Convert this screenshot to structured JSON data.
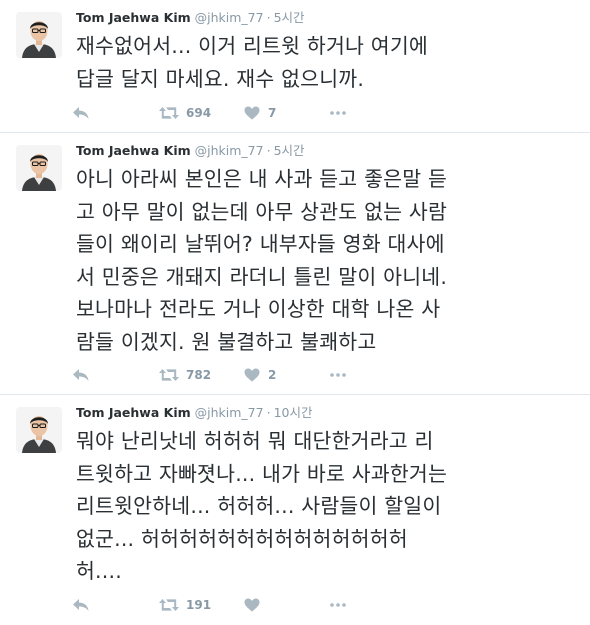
{
  "tweets": [
    {
      "name": "Tom Jaehwa Kim",
      "handle": "@jhkim_77",
      "separator": "·",
      "time": "5시간",
      "text": "재수없어서... 이거 리트윗 하거나 여기에\n답글 달지 마세요. 재수 없으니까.",
      "retweets": "694",
      "likes": "7"
    },
    {
      "name": "Tom Jaehwa Kim",
      "handle": "@jhkim_77",
      "separator": "·",
      "time": "5시간",
      "text": "아니 아라씨 본인은 내 사과 듣고 좋은말 듣\n고 아무 말이 없는데 아무 상관도 없는 사람\n들이 왜이리 날뛰어? 내부자들 영화 대사에\n서 민중은 개돼지 라더니 틀린 말이 아니네.\n보나마나 전라도 거나 이상한 대학 나온 사\n람들 이겠지. 원 불결하고 불쾌하고",
      "retweets": "782",
      "likes": "2"
    },
    {
      "name": "Tom Jaehwa Kim",
      "handle": "@jhkim_77",
      "separator": "·",
      "time": "10시간",
      "text": "뭐야 난리낫네 허허허 뭐 대단한거라고 리\n트윗하고 자빠졋나... 내가 바로 사과한거는\n리트윗안하네... 허허허... 사람들이 할일이\n없군... 허허허허허허허허허허허허허허\n허....",
      "retweets": "191",
      "likes": ""
    }
  ],
  "icons": {
    "reply": "reply-arrow-icon",
    "retweet": "retweet-icon",
    "like": "heart-icon",
    "more": "more-dots-icon"
  },
  "colors": {
    "icon": "#aab8c2",
    "meta": "#8899a6",
    "text": "#292f33",
    "divider": "#e1e8ed"
  }
}
